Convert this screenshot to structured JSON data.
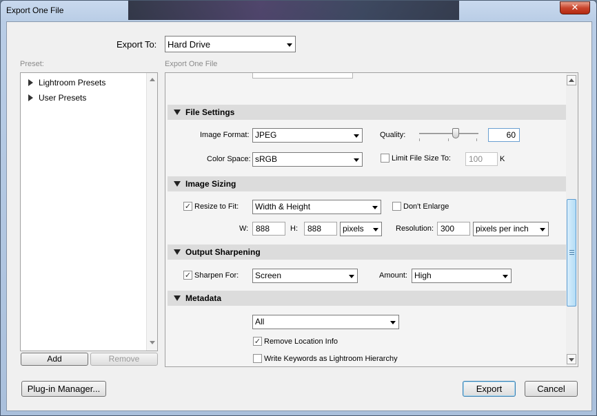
{
  "window": {
    "title": "Export One File",
    "close_glyph": "✕"
  },
  "export_to": {
    "label": "Export To:",
    "value": "Hard Drive"
  },
  "preset": {
    "label": "Preset:",
    "items": [
      {
        "label": "Lightroom Presets"
      },
      {
        "label": "User Presets"
      }
    ],
    "add_label": "Add",
    "remove_label": "Remove"
  },
  "panel": {
    "header": "Export One File",
    "file_settings": {
      "title": "File Settings",
      "image_format_label": "Image Format:",
      "image_format": "JPEG",
      "quality_label": "Quality:",
      "quality_value": "60",
      "quality_fraction": 0.6,
      "color_space_label": "Color Space:",
      "color_space": "sRGB",
      "limit_label": "Limit File Size To:",
      "limit_checked": false,
      "limit_value": "100",
      "limit_unit": "K"
    },
    "image_sizing": {
      "title": "Image Sizing",
      "resize_label": "Resize to Fit:",
      "resize_checked": true,
      "resize_mode": "Width & Height",
      "dont_enlarge_label": "Don't Enlarge",
      "dont_enlarge_checked": false,
      "w_label": "W:",
      "w_value": "888",
      "h_label": "H:",
      "h_value": "888",
      "units": "pixels",
      "resolution_label": "Resolution:",
      "resolution_value": "300",
      "resolution_units": "pixels per inch"
    },
    "output_sharpening": {
      "title": "Output Sharpening",
      "sharpen_label": "Sharpen For:",
      "sharpen_checked": true,
      "sharpen_for": "Screen",
      "amount_label": "Amount:",
      "amount": "High"
    },
    "metadata": {
      "title": "Metadata",
      "include": "All",
      "remove_location_label": "Remove Location Info",
      "remove_location_checked": true,
      "write_keywords_label": "Write Keywords as Lightroom Hierarchy",
      "write_keywords_checked": false
    }
  },
  "footer": {
    "plugin_manager_label": "Plug-in Manager...",
    "export_label": "Export",
    "cancel_label": "Cancel"
  }
}
